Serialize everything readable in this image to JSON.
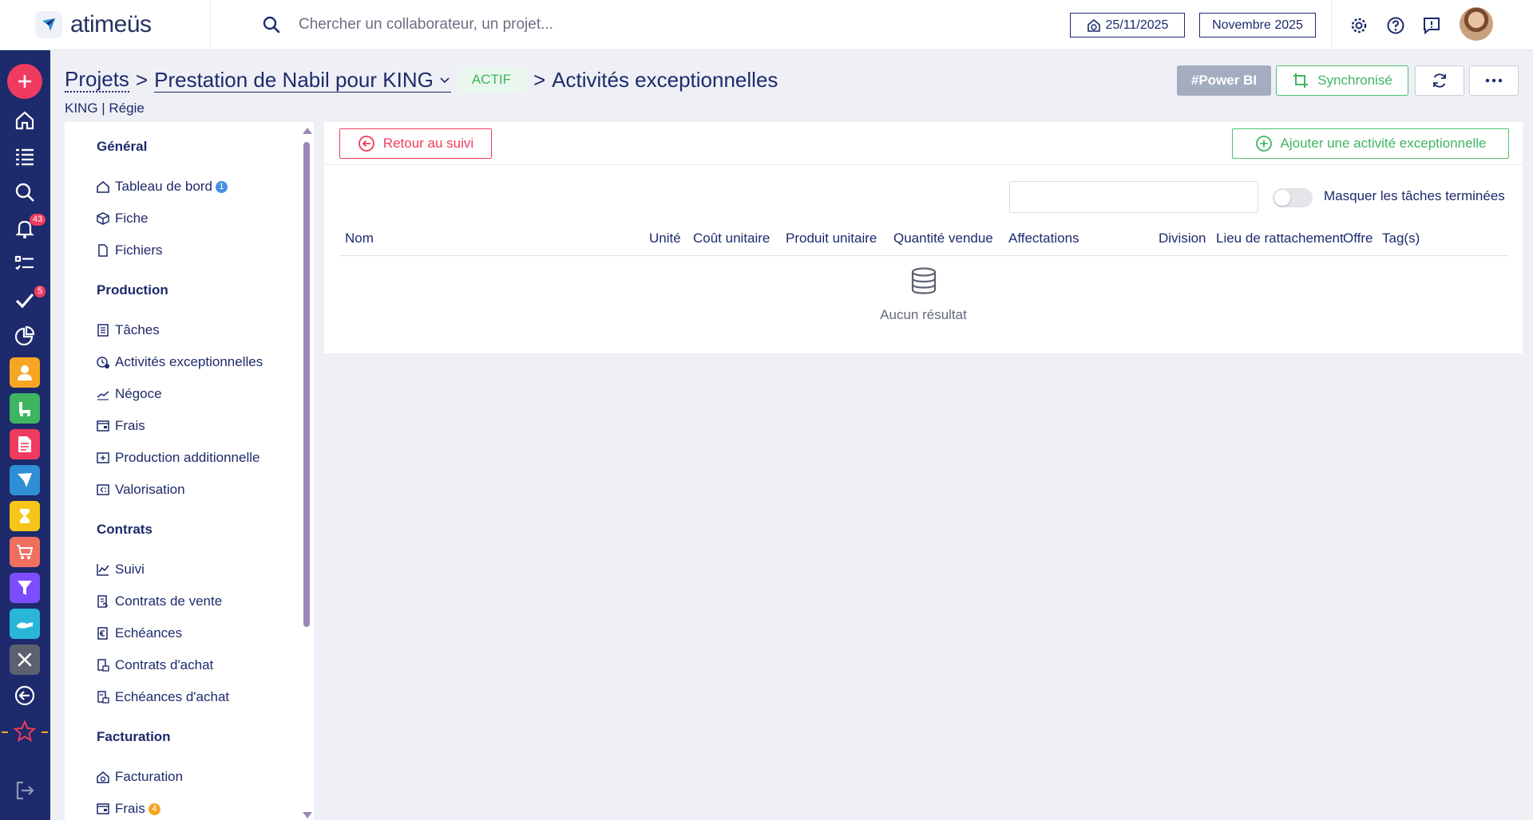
{
  "app": {
    "name": "atimeüs"
  },
  "topbar": {
    "search_placeholder": "Chercher un collaborateur, un projet...",
    "date": "25/11/2025",
    "month": "Novembre 2025"
  },
  "leftnav": {
    "notifications_count": "43",
    "tasks_count": "5"
  },
  "header": {
    "crumb_projects": "Projets",
    "sep1": ">",
    "project_name": "Prestation de Nabil pour KING",
    "status": "ACTIF",
    "sep2": ">",
    "page_title": "Activités exceptionnelles",
    "subline": "KING | Régie",
    "powerbi_label": "#Power BI",
    "sync_label": "Synchronisé"
  },
  "sidebar": {
    "sections": [
      {
        "title": "Général",
        "items": [
          {
            "label": "Tableau de bord",
            "count": "1"
          },
          {
            "label": "Fiche"
          },
          {
            "label": "Fichiers"
          }
        ]
      },
      {
        "title": "Production",
        "items": [
          {
            "label": "Tâches"
          },
          {
            "label": "Activités exceptionnelles"
          },
          {
            "label": "Négoce"
          },
          {
            "label": "Frais"
          },
          {
            "label": "Production additionnelle"
          },
          {
            "label": "Valorisation"
          }
        ]
      },
      {
        "title": "Contrats",
        "items": [
          {
            "label": "Suivi"
          },
          {
            "label": "Contrats de vente"
          },
          {
            "label": "Echéances"
          },
          {
            "label": "Contrats d'achat"
          },
          {
            "label": "Echéances d'achat"
          }
        ]
      },
      {
        "title": "Facturation",
        "items": [
          {
            "label": "Facturation"
          },
          {
            "label": "Frais",
            "count": "4"
          }
        ]
      }
    ]
  },
  "main": {
    "back_label": "Retour au suivi",
    "add_label": "Ajouter une activité exceptionnelle",
    "search_value": "",
    "hide_done_label": "Masquer les tâches terminées",
    "hide_done_on": false,
    "columns": [
      "Nom",
      "Unité",
      "Coût unitaire",
      "Produit unitaire",
      "Quantité vendue",
      "Affectations",
      "Division",
      "Lieu de rattachement",
      "Offre",
      "Tag(s)"
    ],
    "empty_text": "Aucun résultat"
  },
  "colors": {
    "navy": "#1d2a6b",
    "accent_red": "#ef3b5f",
    "accent_green": "#3fb561",
    "background": "#eef0f6"
  }
}
